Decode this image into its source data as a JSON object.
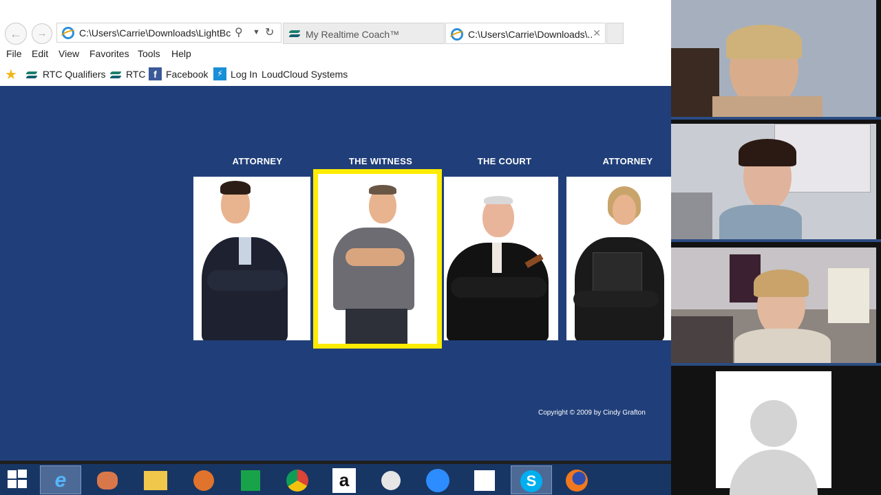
{
  "browser": {
    "address_bar": {
      "value": "C:\\Users\\Carrie\\Downloads\\LightBc"
    },
    "tabs": [
      {
        "label": "My Realtime Coach™"
      },
      {
        "label": "C:\\Users\\Carrie\\Downloads\\..."
      }
    ],
    "menu": [
      "File",
      "Edit",
      "View",
      "Favorites",
      "Tools",
      "Help"
    ],
    "favorites": [
      "RTC Qualifiers",
      "RTC",
      "Facebook",
      "Log In",
      "LoudCloud Systems"
    ]
  },
  "page": {
    "cards": [
      {
        "title": "ATTORNEY",
        "selected": false
      },
      {
        "title": "THE WITNESS",
        "selected": true
      },
      {
        "title": "THE COURT",
        "selected": false
      },
      {
        "title": "ATTORNEY",
        "selected": false
      }
    ],
    "copyright": "Copyright © 2009 by Cindy Grafton",
    "background_color": "#203f7a",
    "selection_color": "#ffec00"
  },
  "taskbar": {
    "icons": [
      "windows-start-icon",
      "internet-explorer-icon",
      "pinned-app-icon",
      "file-explorer-icon",
      "basketball-app-icon",
      "store-icon",
      "chrome-icon",
      "amazon-icon",
      "app-icon",
      "zoom-icon",
      "apps-grid-icon",
      "skype-icon",
      "firefox-icon"
    ]
  },
  "video_panel": {
    "participants": [
      "participant-1",
      "participant-2",
      "participant-3",
      "participant-4-no-video"
    ]
  }
}
